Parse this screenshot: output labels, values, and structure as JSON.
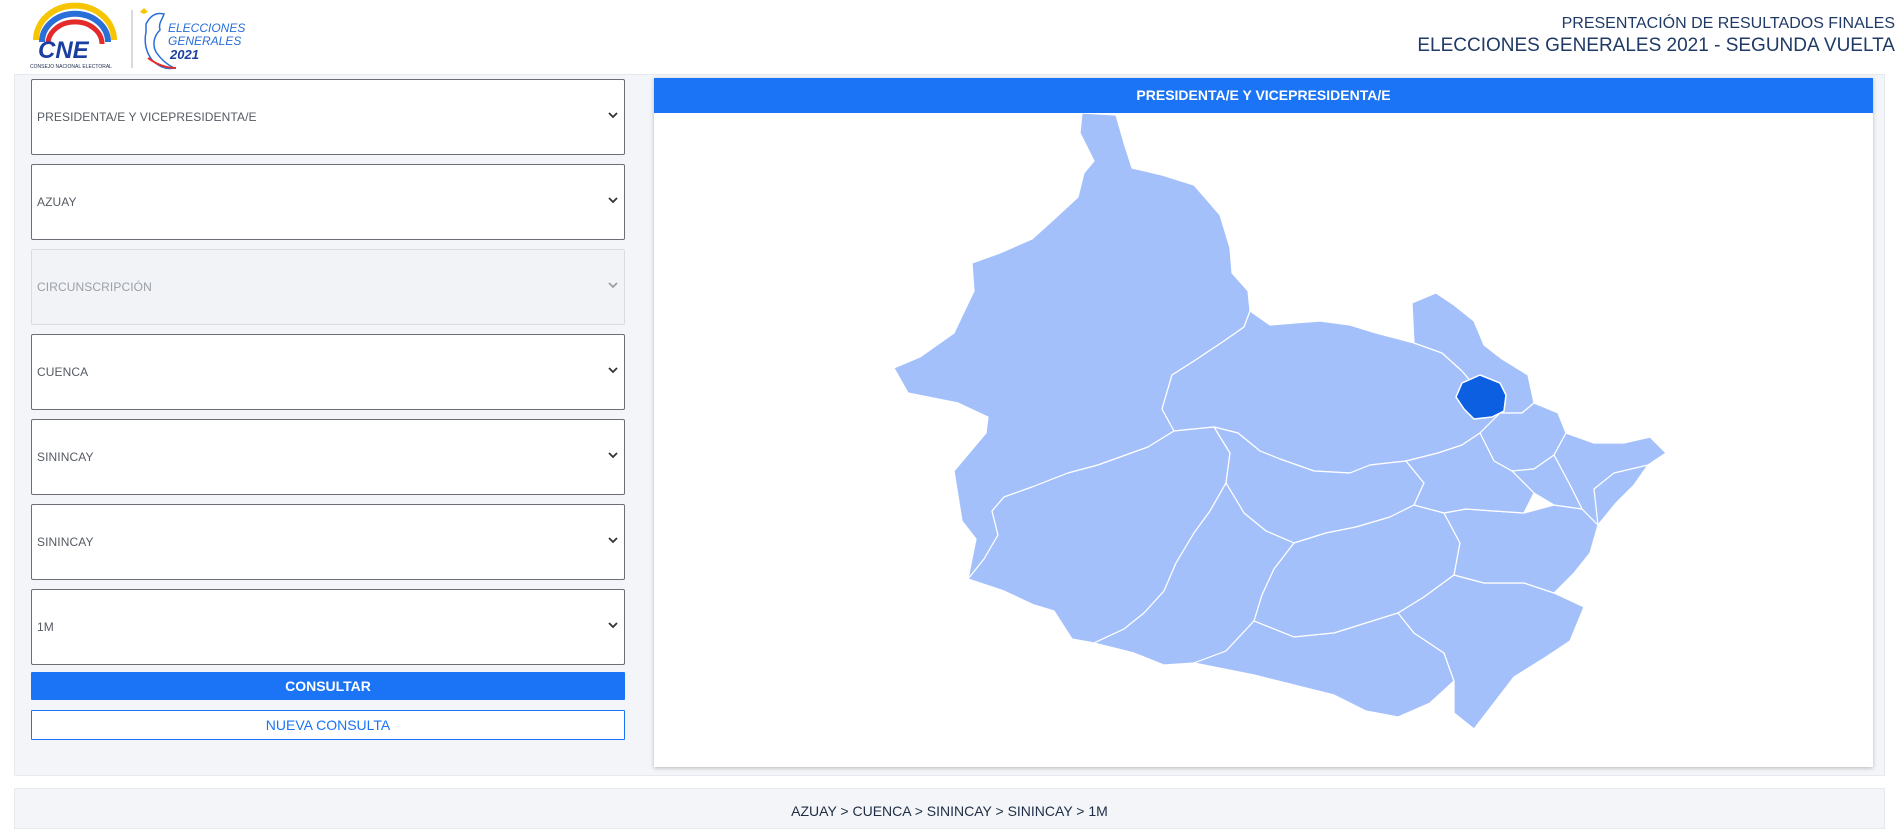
{
  "header": {
    "logo_cne_text": "CNE",
    "logo_cne_subtitle": "CONSEJO NACIONAL ELECTORAL",
    "logo_elecciones_line1": "ELECCIONES",
    "logo_elecciones_line2": "GENERALES",
    "logo_elecciones_year": "2021",
    "title_line1": "PRESENTACIÓN DE RESULTADOS FINALES",
    "title_line2": "ELECCIONES GENERALES 2021 - SEGUNDA VUELTA"
  },
  "filters": {
    "dignidad": "PRESIDENTA/E Y VICEPRESIDENTA/E",
    "provincia": "AZUAY",
    "circunscripcion": "CIRCUNSCRIPCIÓN",
    "canton": "CUENCA",
    "parroquia": "SININCAY",
    "zona": "SININCAY",
    "junta": "1M"
  },
  "buttons": {
    "consultar": "CONSULTAR",
    "nueva_consulta": "NUEVA CONSULTA"
  },
  "map": {
    "title": "PRESIDENTA/E Y VICEPRESIDENTA/E",
    "colors": {
      "base": "#a4c0fb",
      "highlight": "#0b5fe0",
      "border": "#ffffff"
    }
  },
  "footer": {
    "breadcrumb": "AZUAY > CUENCA > SININCAY > SININCAY > 1M"
  },
  "colors": {
    "accent": "#1a74f5",
    "header_text": "#1f3a66"
  }
}
